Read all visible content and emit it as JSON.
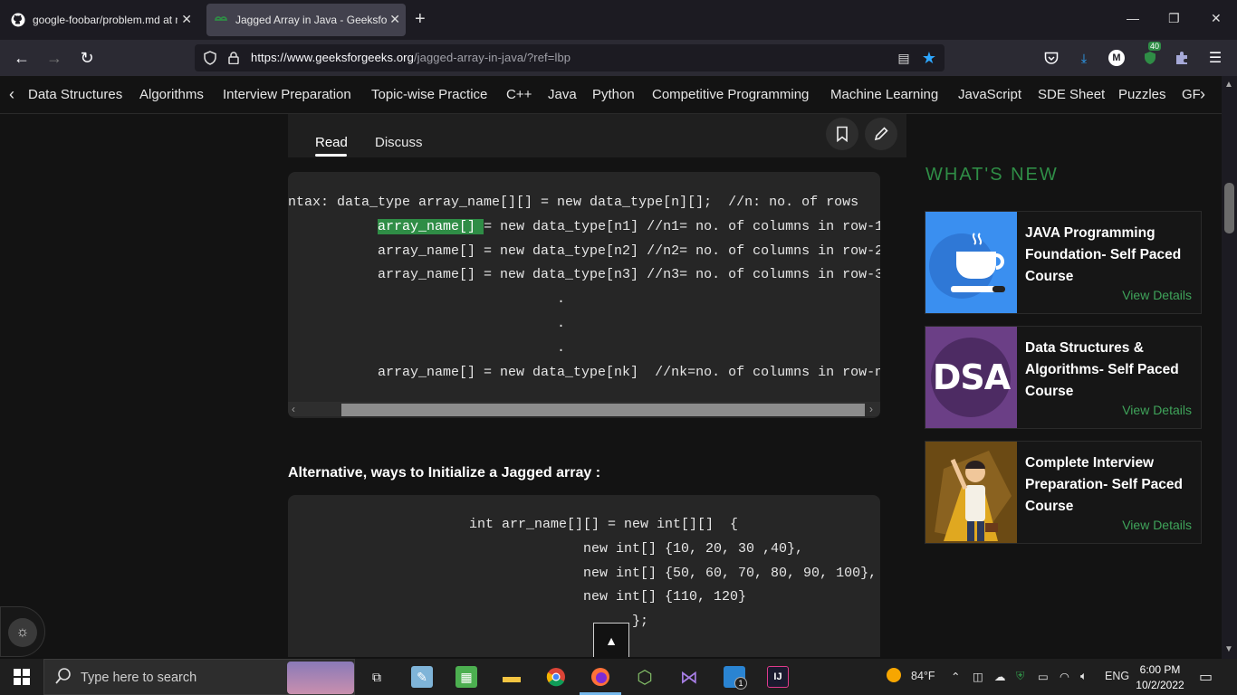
{
  "browser": {
    "tabs": [
      {
        "title": "google-foobar/problem.md at ma",
        "active": false
      },
      {
        "title": "Jagged Array in Java - GeeksforG",
        "active": true
      }
    ],
    "url_host": "https://www.geeksforgeeks.org",
    "url_path": "/jagged-array-in-java/?ref=lbp",
    "extension_badge": "40",
    "profile_initial": "M"
  },
  "sitenav": {
    "items": [
      "Data Structures",
      "Algorithms",
      "Interview Preparation",
      "Topic-wise Practice",
      "C++",
      "Java",
      "Python",
      "Competitive Programming",
      "Machine Learning",
      "JavaScript",
      "SDE Sheet",
      "Puzzles",
      "GFG"
    ]
  },
  "article": {
    "tabs": {
      "read": "Read",
      "discuss": "Discuss"
    },
    "code1_lines": [
      "ntax: data_type array_name[][] = new data_type[n][];  //n: no. of rows",
      "           array_name[] = new data_type[n1] //n1= no. of columns in row-1",
      "           array_name[] = new data_type[n2] //n2= no. of columns in row-2",
      "           array_name[] = new data_type[n3] //n3= no. of columns in row-3",
      "                                 .",
      "                                 .",
      "                                 .",
      "           array_name[] = new data_type[nk]  //nk=no. of columns in row-n"
    ],
    "code1_highlight": "array_name[] ",
    "alt_heading": "Alternative, ways to Initialize a Jagged array :",
    "code2_lines": [
      "int arr_name[][] = new int[][]  {",
      "              new int[] {10, 20, 30 ,40},",
      "              new int[] {50, 60, 70, 80, 90, 100},",
      "              new int[] {110, 120}",
      "                    };"
    ]
  },
  "sidebar": {
    "heading": "WHAT'S NEW",
    "courses": [
      {
        "title": "JAVA Programming Foundation- Self Paced Course",
        "link": "View Details",
        "thumb_icon": "coffee-cup-icon",
        "thumb_color": "#3a8ff0"
      },
      {
        "title": "Data Structures & Algorithms- Self Paced Course",
        "link": "View Details",
        "thumb_icon": "dsa-logo",
        "thumb_text": "DSA",
        "thumb_color": "#6b3f86"
      },
      {
        "title": "Complete Interview Preparation- Self Paced Course",
        "link": "View Details",
        "thumb_icon": "person-cape-icon",
        "thumb_color": "#9c6a1a"
      }
    ]
  },
  "taskbar": {
    "search_placeholder": "Type here to search",
    "weather": "84°F",
    "language": "ENG",
    "time": "6:00 PM",
    "date": "10/2/2022",
    "badge": "1"
  },
  "colors": {
    "accent_green": "#2f8d46",
    "page_bg": "#131313",
    "code_bg": "#262626"
  }
}
